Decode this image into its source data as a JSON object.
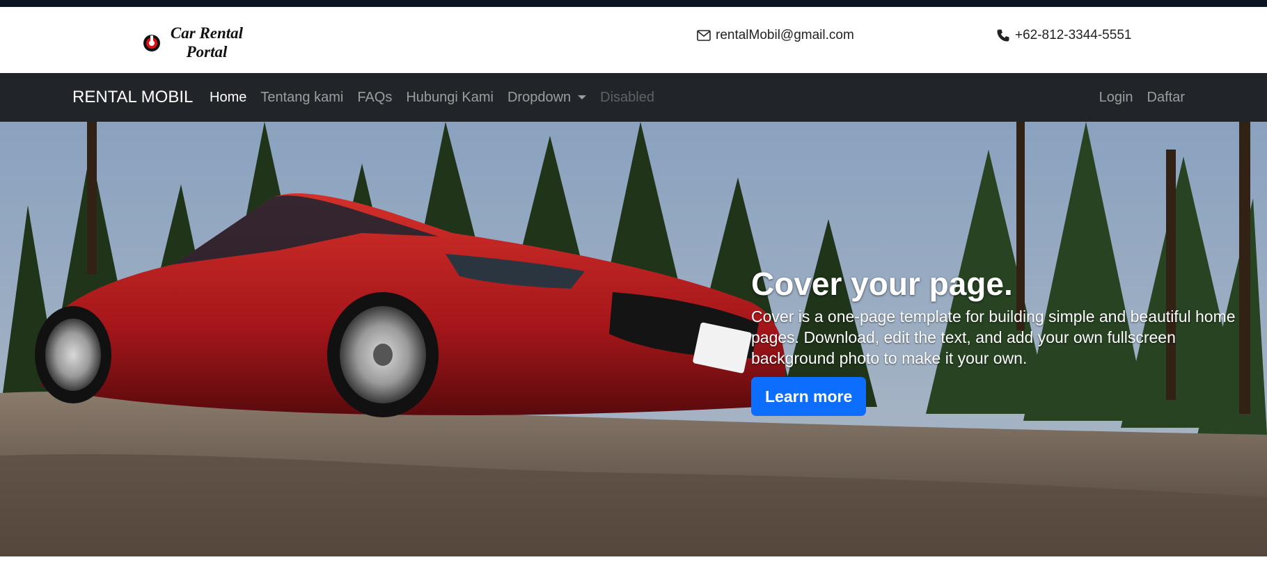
{
  "logo": {
    "text": "Car Rental Portal",
    "line1": "Car Rental",
    "line2": "Portal"
  },
  "contact": {
    "email": "rentalMobil@gmail.com",
    "phone": "+62-812-3344-5551"
  },
  "navbar": {
    "brand": "RENTAL MOBIL",
    "links": [
      {
        "label": "Home",
        "state": "active"
      },
      {
        "label": "Tentang kami",
        "state": "normal"
      },
      {
        "label": "FAQs",
        "state": "normal"
      },
      {
        "label": "Hubungi Kami",
        "state": "normal"
      },
      {
        "label": "Dropdown",
        "state": "dropdown"
      },
      {
        "label": "Disabled",
        "state": "disabled"
      }
    ],
    "right": [
      {
        "label": "Login"
      },
      {
        "label": "Daftar"
      }
    ]
  },
  "hero": {
    "title": "Cover your page.",
    "lead": "Cover is a one-page template for building simple and beautiful home pages. Download, edit the text, and add your own fullscreen background photo to make it your own.",
    "button": "Learn more"
  },
  "colors": {
    "top_strip": "#0c1424",
    "navbar_bg": "#212529",
    "button_primary": "#0d6efd",
    "car_red": "#b81d1d"
  },
  "icons": {
    "email": "envelope-icon",
    "phone": "phone-icon",
    "logo": "car-rental-logo-mark"
  }
}
